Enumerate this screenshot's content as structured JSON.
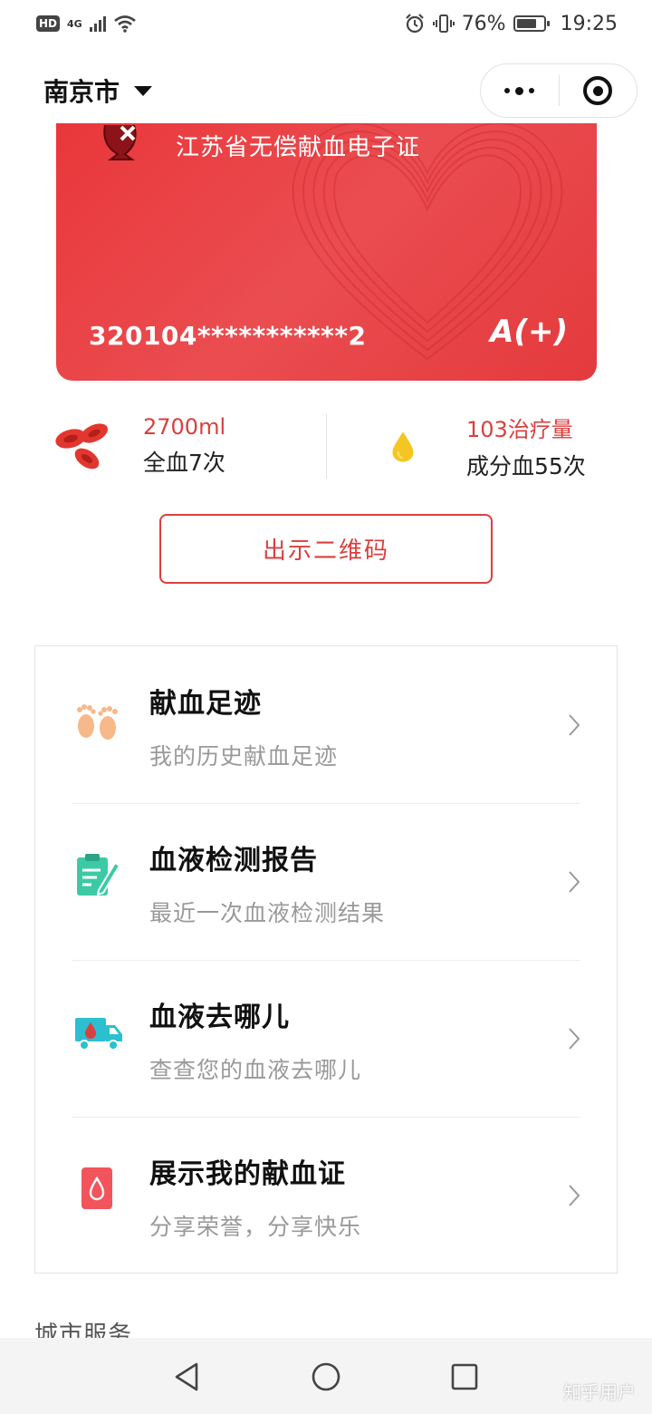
{
  "status_bar": {
    "hd": "HD",
    "network": "4G",
    "battery_percent": "76%",
    "battery_level": 0.76,
    "time": "19:25"
  },
  "header": {
    "city": "南京市"
  },
  "card": {
    "title": "江苏省无偿献血电子证",
    "id_number": "320104***********2",
    "blood_type": "A(+)"
  },
  "stats": {
    "whole_blood": {
      "value": "2700ml",
      "label": "全血7次"
    },
    "component_blood": {
      "value": "103治疗量",
      "label": "成分血55次"
    }
  },
  "qr_button": "出示二维码",
  "menu": [
    {
      "title": "献血足迹",
      "subtitle": "我的历史献血足迹",
      "icon": "footprints-icon"
    },
    {
      "title": "血液检测报告",
      "subtitle": "最近一次血液检测结果",
      "icon": "clipboard-report-icon"
    },
    {
      "title": "血液去哪儿",
      "subtitle": "查查您的血液去哪儿",
      "icon": "delivery-truck-icon"
    },
    {
      "title": "展示我的献血证",
      "subtitle": "分享荣誉，分享快乐",
      "icon": "blood-drop-certificate-icon"
    }
  ],
  "section_label": "城市服务",
  "watermark": "知乎用户",
  "colors": {
    "brand_red": "#e9373b",
    "accent_red": "#d9403e",
    "drop_yellow": "#f5c623",
    "teal": "#3ccaa6"
  }
}
